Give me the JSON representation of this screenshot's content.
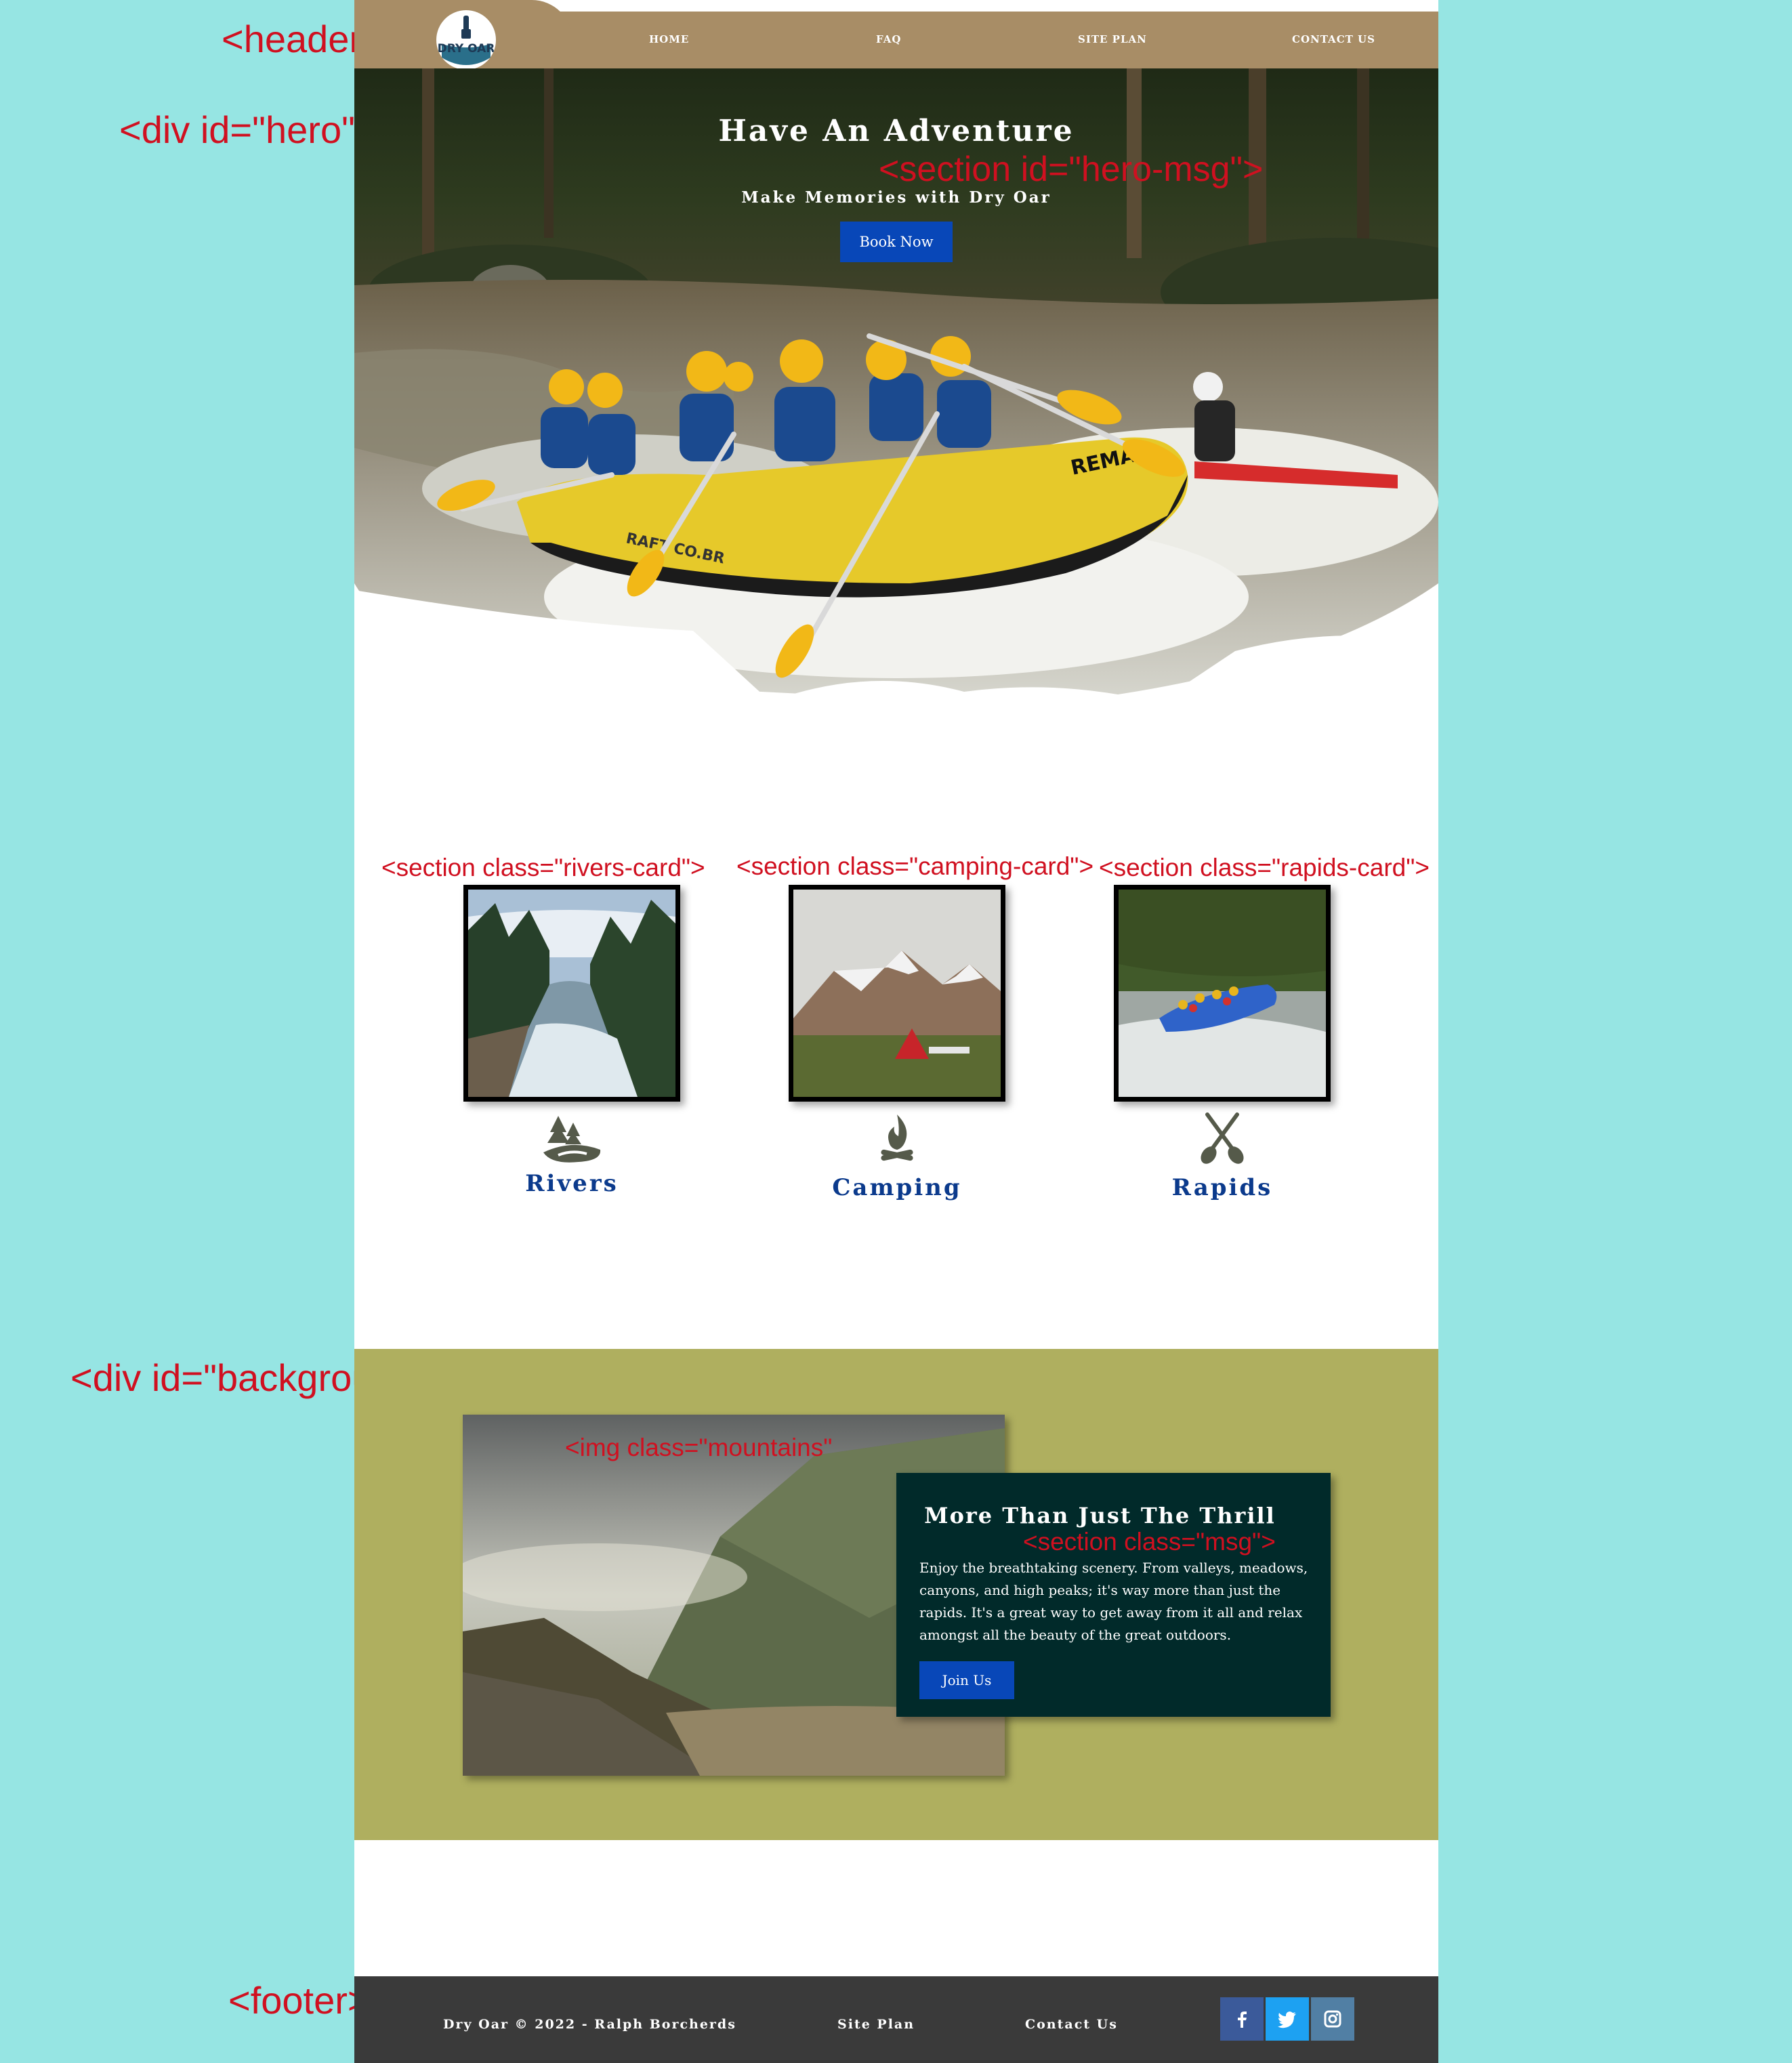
{
  "annotations": {
    "header": "<header>",
    "hero": "<div id=\"hero\">",
    "hero_msg": "<section id=\"hero-msg\">",
    "rivers_card": "<section class=\"rivers-card\">",
    "camping_card": "<section class=\"camping-card\">",
    "rapids_card": "<section class=\"rapids-card\">",
    "background": "<div id=\"background\"></div>",
    "mountains": "<img class=\"mountains\"",
    "msg": "<section class=\"msg\">",
    "footer": "<footer>"
  },
  "header": {
    "logo_text": "DRY OAR",
    "nav": [
      "HOME",
      "FAQ",
      "SITE PLAN",
      "CONTACT US"
    ],
    "bg_color": "#a88d66"
  },
  "hero": {
    "title": "Have An Adventure",
    "subtitle": "Make Memories with Dry Oar",
    "button": "Book Now",
    "raft_text_1": "REMAR",
    "raft_text_2": "RAFT CO.BR"
  },
  "cards": [
    {
      "label": "Rivers",
      "icon": "river-trees-icon"
    },
    {
      "label": "Camping",
      "icon": "campfire-icon"
    },
    {
      "label": "Rapids",
      "icon": "crossed-paddles-icon"
    }
  ],
  "about": {
    "title": "More Than Just The Thrill",
    "body": "Enjoy the breathtaking scenery. From valleys, meadows, canyons, and high peaks; it's way more than just the rapids. It's a great way to get away from it all and relax amongst all the beauty of the great outdoors.",
    "button": "Join Us",
    "band_color": "#afaf5f",
    "panel_color": "#012a2a"
  },
  "footer": {
    "copyright": "Dry Oar © 2022 - Ralph Borcherds",
    "site_plan": "Site Plan",
    "contact": "Contact Us",
    "social": [
      "facebook-icon",
      "twitter-icon",
      "instagram-icon"
    ]
  },
  "colors": {
    "page_bg": "#96e5e3",
    "annotation": "#d01020",
    "accent_blue": "#0847b8",
    "label_blue": "#0b3a8c",
    "footer_bg": "#3a3a3a"
  }
}
